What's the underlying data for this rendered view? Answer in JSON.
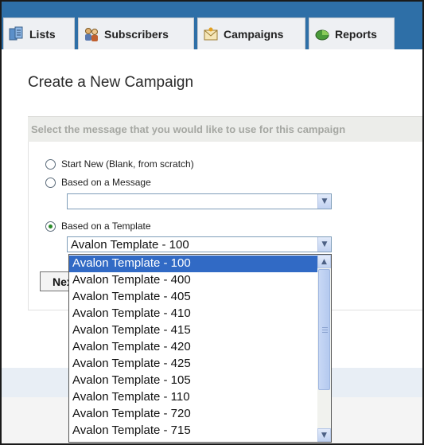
{
  "tabs": [
    {
      "label": "Lists",
      "icon": "lists-icon"
    },
    {
      "label": "Subscribers",
      "icon": "subscribers-icon"
    },
    {
      "label": "Campaigns",
      "icon": "campaigns-icon"
    },
    {
      "label": "Reports",
      "icon": "reports-icon"
    }
  ],
  "page": {
    "title": "Create a New Campaign",
    "instruction": "Select the message that you would like to use for this campaign"
  },
  "options": {
    "start_new": "Start New (Blank, from scratch)",
    "based_on_message": "Based on a Message",
    "based_on_template": "Based on a Template",
    "selected": "based_on_template"
  },
  "message_select": {
    "value": ""
  },
  "template_select": {
    "value": "Avalon Template - 100",
    "options": [
      "Avalon Template - 100",
      "Avalon Template - 400",
      "Avalon Template - 405",
      "Avalon Template - 410",
      "Avalon Template - 415",
      "Avalon Template - 420",
      "Avalon Template - 425",
      "Avalon Template - 105",
      "Avalon Template - 110",
      "Avalon Template - 720",
      "Avalon Template - 715"
    ],
    "highlighted_index": 0
  },
  "next_button": {
    "label": "Next"
  },
  "colors": {
    "tabbar": "#2e6fa7",
    "highlight": "#316ac5",
    "instruction_text": "#a5a7a2"
  }
}
